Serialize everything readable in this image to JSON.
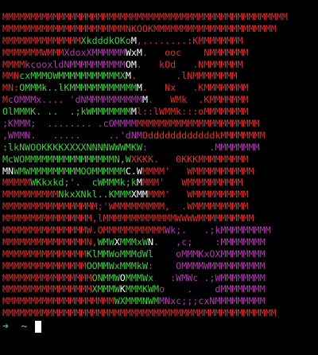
{
  "palette": {
    "r": "#e02e2e",
    "g": "#3fd23f",
    "w": "#ffffff",
    "m": "#b23ab0",
    "bg": "#000000"
  },
  "art_lines": [
    [
      [
        "r",
        "MMMMMMMMMMMMMMMMMMMMMMMMMMMMMMMMMMMMMMMMMMMMMMMMMMM"
      ]
    ],
    [
      [
        "r",
        "MMMMMMMMMMMMMMMMMMMMMMNKOOKMMMMMMMMMMMMMMMMMMMMMM"
      ]
    ],
    [
      [
        "r",
        "MMMMMMMMMMMMMM"
      ],
      [
        "g",
        "XkdddkOKo"
      ],
      [
        "w",
        "M"
      ],
      [
        "r",
        ",........:KMMMMMMMM"
      ]
    ],
    [
      [
        "r",
        "MMMMMMMWMMM"
      ],
      [
        "m",
        "XdoxXMMMMMM"
      ],
      [
        "w",
        "WxM"
      ],
      [
        "r",
        ".   ooc    NMMMMMMM"
      ]
    ],
    [
      [
        "r",
        "MMMM"
      ],
      [
        "m",
        "kcooxldNMMMMMMMMMM"
      ],
      [
        "w",
        "OM"
      ],
      [
        "r",
        ".   kOd   .NMMMMMMM"
      ]
    ],
    [
      [
        "r",
        "MMN"
      ],
      [
        "g",
        "cxMMMOWMMMMMMMMMMMX"
      ],
      [
        "w",
        "M"
      ],
      [
        "r",
        ".       .lNMMMMMMMM"
      ]
    ],
    [
      [
        "r",
        "MN:"
      ],
      [
        "g",
        "OMMMk..lKMMMMMMMMMMMM"
      ],
      [
        "w",
        "M"
      ],
      [
        "r",
        ".   Nx   .KMMMMMMMM"
      ]
    ],
    [
      [
        "r",
        "M"
      ],
      [
        "m",
        "cOMMMx.... 'dNMMMMMMMMMM"
      ],
      [
        "w",
        "M"
      ],
      [
        "r",
        ".   WMk  .KMMMMMMM"
      ]
    ],
    [
      [
        "g",
        "OlMMMK. ..  .;kWMMMMMMM"
      ],
      [
        "w",
        "M"
      ],
      [
        "r",
        "l::lWMMk:::oMMMMMMMM"
      ]
    ],
    [
      [
        "m",
        ";KMMM;  ........ .cOMMMM"
      ],
      [
        "r",
        "MMMMMMMMMMMMMMMMMMMMMM"
      ]
    ],
    [
      [
        "m",
        ",WMMN.   .....     ..'dNM"
      ],
      [
        "r",
        "OddddddddddddkMMMMMMMM"
      ]
    ],
    [
      [
        "g",
        ":lkNWOOKKKKXXXXNNNNWWWMKW"
      ],
      [
        "m",
        ":           .MMMMMMMM"
      ]
    ],
    [
      [
        "g",
        "McWOMMMMMMMMMMMMMMMMN,W"
      ],
      [
        "r",
        "XKKK.   0KKKMMMMMMMMM"
      ]
    ],
    [
      [
        "w",
        "MN"
      ],
      [
        "g",
        "WMWMMMMMMMMMOOMMMMMM"
      ],
      [
        "w",
        "C.W"
      ],
      [
        "r",
        "MMMM'   WMMMMMMMMMMM"
      ]
    ],
    [
      [
        "r",
        "MMMMM"
      ],
      [
        "g",
        "WKkxkd;'.  cWMMMk;k"
      ],
      [
        "w",
        "M"
      ],
      [
        "r",
        "MMM'   WMMMMMMMMMM"
      ]
    ],
    [
      [
        "r",
        "MMMMMMMMMM"
      ],
      [
        "g",
        "NkxXNkl..KMMM"
      ],
      [
        "w",
        "XMM"
      ],
      [
        "r",
        "MMM'   WMMMMMMMMMM"
      ]
    ],
    [
      [
        "r",
        "MMMMMMMMMMMMMMMMM;'WMMMMMMMMM,  .WMMMMMMMMMM"
      ]
    ],
    [
      [
        "r",
        "MMMMMMMMMMMMMMMM,lMMMMMMMMMMMMMWWWWMMMMMMMMMM"
      ]
    ],
    [
      [
        "r",
        "MMMMMMMMMMMMMMMW.OMMMMMMMMMMM"
      ],
      [
        "m",
        "Wk;.   .;kMMMMMMMMM"
      ]
    ],
    [
      [
        "r",
        "MMMMMMMMMMMMMMMN,"
      ],
      [
        "g",
        "WMW"
      ],
      [
        "w",
        "X"
      ],
      [
        "g",
        "MMMxW"
      ],
      [
        "w",
        "N"
      ],
      [
        "m",
        ".   ,c;    :MMMMMMMM"
      ]
    ],
    [
      [
        "r",
        "MMMMMMMMMMMMMMM"
      ],
      [
        "g",
        "KlMMWoMMMdWl"
      ],
      [
        "m",
        "    oMMMKxOXMMMMMMMM"
      ]
    ],
    [
      [
        "r",
        "MMMMMMMMMMMMMMM"
      ],
      [
        "g",
        "OOMMWxMMMkW"
      ],
      [
        "m",
        ":    OMMMMWMMMMMMMMMM"
      ]
    ],
    [
      [
        "r",
        "MMMMMMMMMMMMMMMM"
      ],
      [
        "g",
        "ONMMW"
      ],
      [
        "w",
        "O"
      ],
      [
        "g",
        "MMMWx"
      ],
      [
        "m",
        "   :WMWc .;WMMMMMMMM"
      ]
    ],
    [
      [
        "r",
        "MMMMMMMMMMMMMMMM"
      ],
      [
        "g",
        "XMMMW"
      ],
      [
        "w",
        "K"
      ],
      [
        "g",
        "MMMKWM"
      ],
      [
        "m",
        "o    .    dMMMMMMMM"
      ]
    ],
    [
      [
        "r",
        "MMMMMMMMMMMMMMMMMMMM"
      ],
      [
        "g",
        "WXMMMNWM"
      ],
      [
        "m",
        "MNxc;;;cxNMMMMMMMMM"
      ]
    ],
    [
      [
        "r",
        "MMMMMMMMMMMMMMMMMMMMMMMMMMMMMMMMMMMMMMMMMMMMMMMMM"
      ]
    ]
  ],
  "prompt": {
    "arrow": "➜",
    "path": "~",
    "arrow_color": "#3fd23f",
    "path_color": "#4ec9e0"
  }
}
